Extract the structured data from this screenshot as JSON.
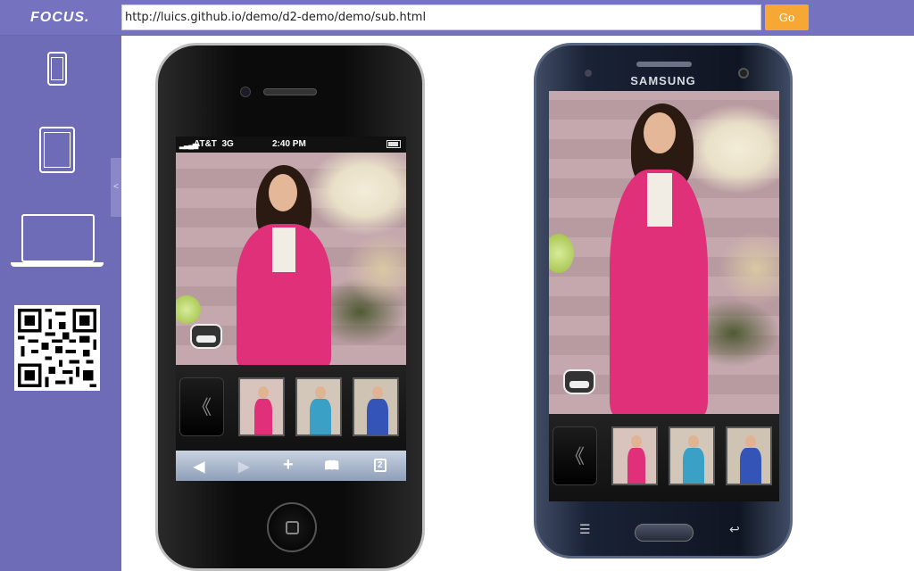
{
  "app": {
    "logo": "FOCUS."
  },
  "toolbar": {
    "url": "http://luics.github.io/demo/d2-demo/demo/sub.html",
    "go_label": "Go"
  },
  "sidebar": {
    "collapse_glyph": "<",
    "devices": [
      "phone-icon",
      "tablet-icon",
      "laptop-icon"
    ],
    "qr": "qr-code"
  },
  "iphone": {
    "carrier": "AT&T",
    "network": "3G",
    "time": "2:40 PM",
    "toolbar": {
      "back": "◀",
      "forward": "▶",
      "add": "+",
      "bookmarks": "📖",
      "tabs": "2"
    }
  },
  "samsung": {
    "brand": "SAMSUNG"
  },
  "gallery": {
    "nav_glyph": "《",
    "thumbs": [
      "pink-cardigan",
      "blue-cardigan",
      "blue-dress"
    ]
  },
  "colors": {
    "sidebar": "#6e6cb7",
    "topbar": "#7573bf",
    "go": "#f7a733",
    "cardigan": "#e0307a"
  }
}
